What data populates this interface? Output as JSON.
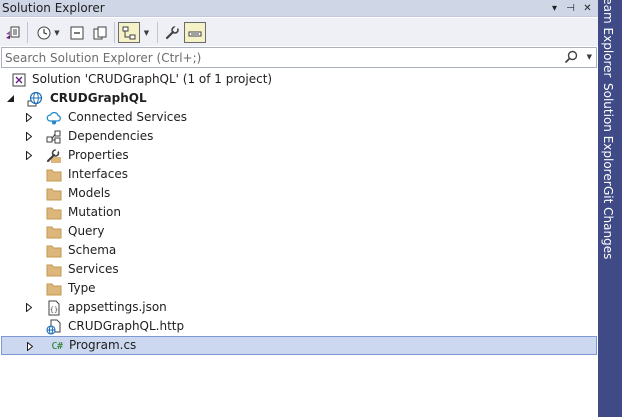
{
  "panel": {
    "title": "Solution Explorer",
    "ctrl_dropdown": "▾",
    "ctrl_pin": "⊣",
    "ctrl_close": "✕"
  },
  "search": {
    "placeholder": "Search Solution Explorer (Ctrl+;)",
    "value": ""
  },
  "tree": {
    "solution": "Solution 'CRUDGraphQL' (1 of 1 project)",
    "project": "CRUDGraphQL",
    "items": [
      {
        "label": "Connected Services",
        "icon": "connected-services-icon"
      },
      {
        "label": "Dependencies",
        "icon": "dependencies-icon"
      },
      {
        "label": "Properties",
        "icon": "wrench-icon"
      },
      {
        "label": "Interfaces",
        "icon": "folder-icon"
      },
      {
        "label": "Models",
        "icon": "folder-icon"
      },
      {
        "label": "Mutation",
        "icon": "folder-icon"
      },
      {
        "label": "Query",
        "icon": "folder-icon"
      },
      {
        "label": "Schema",
        "icon": "folder-icon"
      },
      {
        "label": "Services",
        "icon": "folder-icon"
      },
      {
        "label": "Type",
        "icon": "folder-icon"
      },
      {
        "label": "appsettings.json",
        "icon": "json-file-icon"
      },
      {
        "label": "CRUDGraphQL.http",
        "icon": "http-file-icon"
      },
      {
        "label": "Program.cs",
        "icon": "csharp-file-icon",
        "icon_text": "C#"
      }
    ]
  },
  "side_tabs": [
    "Team Explorer",
    "Solution Explorer",
    "Git Changes"
  ],
  "colors": {
    "title_bar": "#cfd6e5",
    "toolbar": "#eef0f5",
    "selection": "#ccd8f0",
    "selection_border": "#7d99d3",
    "side_strip": "#3f4a86",
    "folder": "#dcb67a"
  }
}
